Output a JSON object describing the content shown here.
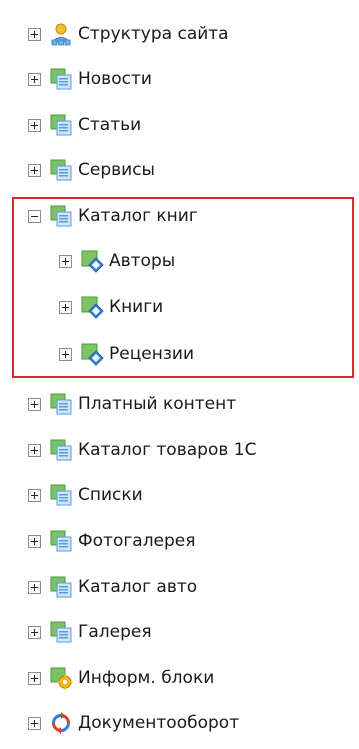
{
  "highlight_color": "#e0252c",
  "tree": [
    {
      "label": "Структура сайта",
      "icon": "site-structure-icon",
      "state": "collapsed",
      "level": 0
    },
    {
      "label": "Новости",
      "icon": "iblock-type-icon",
      "state": "collapsed",
      "level": 0
    },
    {
      "label": "Статьи",
      "icon": "iblock-type-icon",
      "state": "collapsed",
      "level": 0
    },
    {
      "label": "Сервисы",
      "icon": "iblock-type-icon",
      "state": "collapsed",
      "level": 0
    },
    {
      "label": "Каталог книг",
      "icon": "iblock-type-icon",
      "state": "expanded",
      "level": 0
    },
    {
      "label": "Авторы",
      "icon": "iblock-icon",
      "state": "collapsed",
      "level": 1
    },
    {
      "label": "Книги",
      "icon": "iblock-icon",
      "state": "collapsed",
      "level": 1
    },
    {
      "label": "Рецензии",
      "icon": "iblock-icon",
      "state": "collapsed",
      "level": 1
    },
    {
      "label": "Платный контент",
      "icon": "iblock-type-icon",
      "state": "collapsed",
      "level": 0
    },
    {
      "label": "Каталог товаров 1С",
      "icon": "iblock-type-icon",
      "state": "collapsed",
      "level": 0
    },
    {
      "label": "Списки",
      "icon": "iblock-type-icon",
      "state": "collapsed",
      "level": 0
    },
    {
      "label": "Фотогалерея",
      "icon": "iblock-type-icon",
      "state": "collapsed",
      "level": 0
    },
    {
      "label": "Каталог авто",
      "icon": "iblock-type-icon",
      "state": "collapsed",
      "level": 0
    },
    {
      "label": "Галерея",
      "icon": "iblock-type-icon",
      "state": "collapsed",
      "level": 0
    },
    {
      "label": "Информ. блоки",
      "icon": "iblock-settings-icon",
      "state": "collapsed",
      "level": 0
    },
    {
      "label": "Документооборот",
      "icon": "workflow-icon",
      "state": "collapsed",
      "level": 0
    }
  ]
}
